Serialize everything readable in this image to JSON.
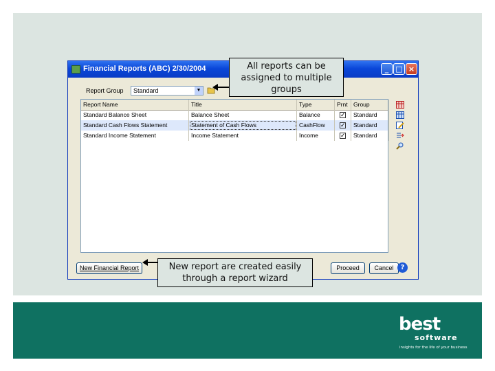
{
  "window": {
    "title": "Financial Reports (ABC) 2/30/2004",
    "report_group_label": "Report Group",
    "report_group_value": "Standard"
  },
  "grid": {
    "columns": [
      "Report Name",
      "Title",
      "Type",
      "Prnt",
      "Group"
    ],
    "rows": [
      {
        "name": "Standard Balance Sheet",
        "title": "Balance Sheet",
        "type": "Balance",
        "print": true,
        "group": "Standard"
      },
      {
        "name": "Standard Cash Flows Statement",
        "title": "Statement of Cash Flows",
        "type": "CashFlow",
        "print": true,
        "group": "Standard"
      },
      {
        "name": "Standard Income Statement",
        "title": "Income Statement",
        "type": "Income",
        "print": true,
        "group": "Standard"
      }
    ]
  },
  "buttons": {
    "new_report": "New Financial Report",
    "proceed": "Proceed",
    "cancel": "Cancel",
    "help": "?"
  },
  "callouts": {
    "top": "All reports can be assigned to multiple groups",
    "bottom": "New report are created easily through a report wizard"
  },
  "logo": {
    "brand": "best",
    "sub": "software",
    "tagline": "insights for the life of your business"
  },
  "icons": [
    "app-icon",
    "folder-icon",
    "grid-red-icon",
    "grid-blue-icon",
    "edit-report-icon",
    "export-icon",
    "find-icon"
  ],
  "colors": {
    "slide_bg": "#dce5e1",
    "footer_bg": "#0f7161",
    "titlebar": "#0a46d8"
  }
}
